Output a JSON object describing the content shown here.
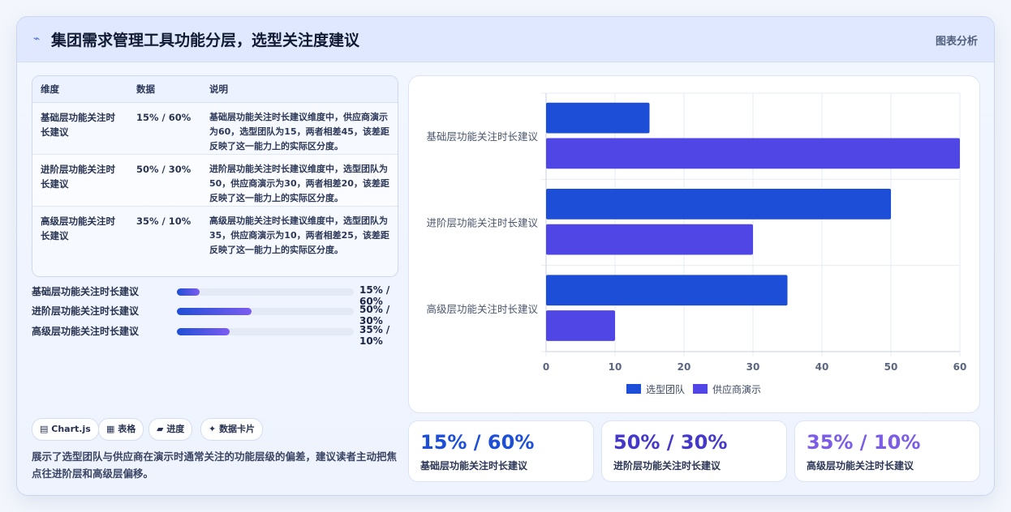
{
  "header": {
    "icon": "sparkline-icon",
    "title": "集团需求管理工具功能分层，选型关注度建议",
    "link": "图表分析"
  },
  "table": {
    "headers": [
      "维度",
      "数据",
      "说明"
    ],
    "rows": [
      {
        "dimension": "基础层功能关注时长建议",
        "data": "15% / 60%",
        "desc": "基础层功能关注时长建议维度中，供应商演示为60，选型团队为15，两者相差45，该差距反映了这一能力上的实际区分度。"
      },
      {
        "dimension": "进阶层功能关注时长建议",
        "data": "50% / 30%",
        "desc": "进阶层功能关注时长建议维度中，选型团队为50，供应商演示为30，两者相差20，该差距反映了这一能力上的实际区分度。"
      },
      {
        "dimension": "高级层功能关注时长建议",
        "data": "35% / 10%",
        "desc": "高级层功能关注时长建议维度中，选型团队为35，供应商演示为10，两者相差25，该差距反映了这一能力上的实际区分度。"
      }
    ]
  },
  "progress": [
    {
      "label": "基础层功能关注时长建议",
      "value": "15% / 60%",
      "fraction": 0.13
    },
    {
      "label": "进阶层功能关注时长建议",
      "value": "50% / 30%",
      "fraction": 0.42
    },
    {
      "label": "高级层功能关注时长建议",
      "value": "35% / 10%",
      "fraction": 0.3
    }
  ],
  "tags": [
    {
      "icon": "chart-icon",
      "glyph": "▤",
      "label": "Chart.js"
    },
    {
      "icon": "table-icon",
      "glyph": "▦",
      "label": "表格"
    },
    {
      "icon": "progress-icon",
      "glyph": "▰",
      "label": "进度"
    },
    {
      "icon": "card-icon",
      "glyph": "✦",
      "label": "数据卡片"
    }
  ],
  "summary": "展示了选型团队与供应商在演示时通常关注的功能层级的偏差，建议读者主动把焦点往进阶层和高级层偏移。",
  "kpis": [
    {
      "value": "15% / 60%",
      "label": "基础层功能关注时长建议",
      "color": "#1d4ed8"
    },
    {
      "value": "50% / 30%",
      "label": "进阶层功能关注时长建议",
      "color": "#4338ca"
    },
    {
      "value": "35% / 10%",
      "label": "高级层功能关注时长建议",
      "color": "#7c5ce6"
    }
  ],
  "chart_data": {
    "type": "bar",
    "orientation": "horizontal",
    "categories": [
      "基础层功能关注时长建议",
      "进阶层功能关注时长建议",
      "高级层功能关注时长建议"
    ],
    "series": [
      {
        "name": "选型团队",
        "values": [
          15,
          50,
          35
        ],
        "color": "#1d4ed8"
      },
      {
        "name": "供应商演示",
        "values": [
          60,
          30,
          10
        ],
        "color": "#4f46e5"
      }
    ],
    "xlim": [
      0,
      60
    ],
    "xticks": [
      0,
      10,
      20,
      30,
      40,
      50,
      60
    ],
    "grid": true,
    "legend": "bottom"
  }
}
